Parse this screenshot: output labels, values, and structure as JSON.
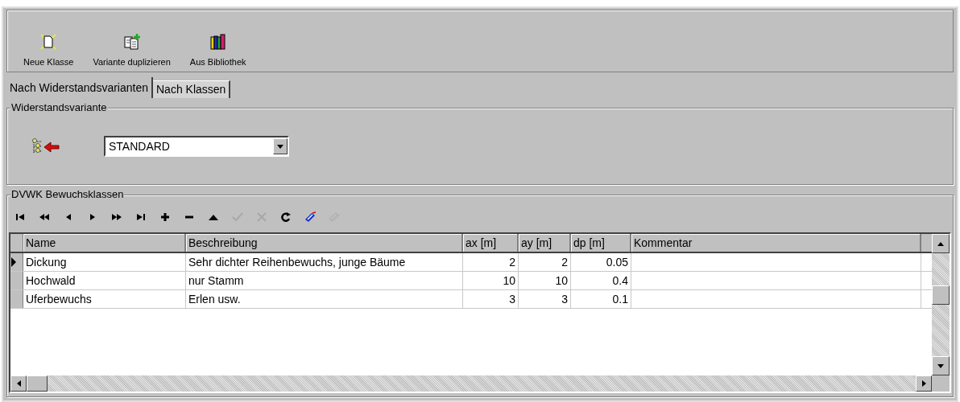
{
  "toolbar": [
    {
      "label": "Neue Klasse",
      "kind": "new"
    },
    {
      "label": "Variante duplizieren",
      "kind": "duplicate"
    },
    {
      "label": "Aus Bibliothek",
      "kind": "library"
    }
  ],
  "tabs": [
    {
      "label": "Nach Widerstandsvarianten",
      "selected": true
    },
    {
      "label": "Nach Klassen",
      "selected": false
    }
  ],
  "variant_group": {
    "title": "Widerstandsvariante",
    "value": "STANDARD"
  },
  "classes_group": {
    "title": "DVWK Bewuchsklassen",
    "navigator": [
      {
        "kind": "first",
        "disabled": false
      },
      {
        "kind": "prior_page",
        "disabled": false
      },
      {
        "kind": "prior",
        "disabled": false
      },
      {
        "kind": "next",
        "disabled": false
      },
      {
        "kind": "next_page",
        "disabled": false
      },
      {
        "kind": "last",
        "disabled": false
      },
      {
        "kind": "insert",
        "disabled": false
      },
      {
        "kind": "delete",
        "disabled": false
      },
      {
        "kind": "edit",
        "disabled": false
      },
      {
        "kind": "post",
        "disabled": true
      },
      {
        "kind": "cancel",
        "disabled": true
      },
      {
        "kind": "refresh",
        "disabled": false
      },
      {
        "kind": "tag",
        "disabled": false
      },
      {
        "kind": "stack",
        "disabled": true
      }
    ],
    "columns": [
      "Name",
      "Beschreibung",
      "ax [m]",
      "ay [m]",
      "dp [m]",
      "Kommentar"
    ],
    "rows": [
      {
        "selected": true,
        "cells": [
          "Dickung",
          "Sehr dichter Reihenbewuchs, junge Bäume",
          "2",
          "2",
          "0.05",
          ""
        ]
      },
      {
        "selected": false,
        "cells": [
          "Hochwald",
          "nur Stamm",
          "10",
          "10",
          "0.4",
          ""
        ]
      },
      {
        "selected": false,
        "cells": [
          "Uferbewuchs",
          "Erlen usw.",
          "3",
          "3",
          "0.1",
          ""
        ]
      }
    ]
  }
}
